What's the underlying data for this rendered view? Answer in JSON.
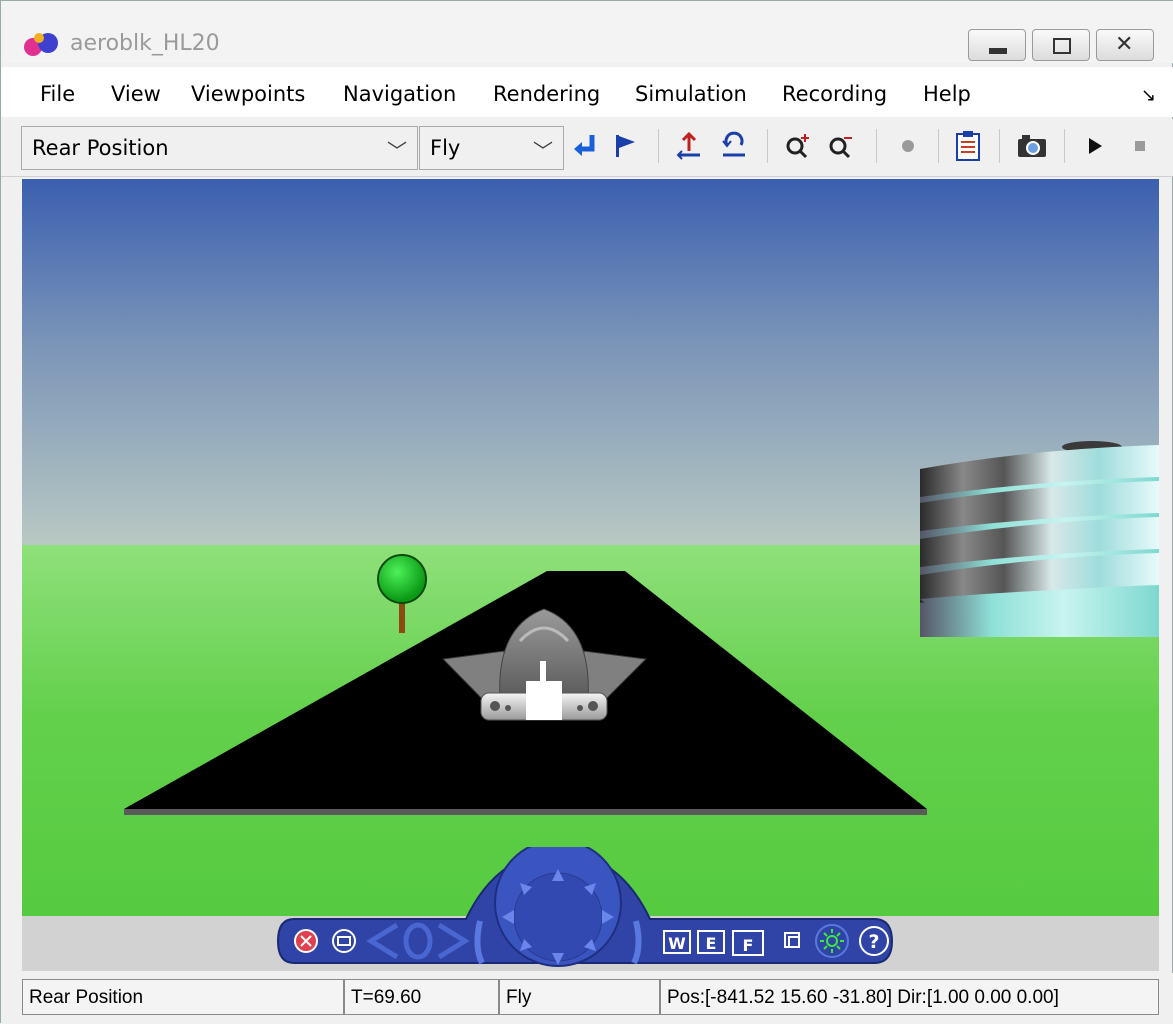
{
  "window": {
    "title": "aeroblk_HL20",
    "controls": [
      "minimize",
      "maximize",
      "close"
    ]
  },
  "menu": {
    "items": [
      "File",
      "View",
      "Viewpoints",
      "Navigation",
      "Rendering",
      "Simulation",
      "Recording",
      "Help"
    ]
  },
  "toolbar": {
    "viewpoint_select": "Rear Position",
    "navigation_select": "Fly",
    "icons": [
      "return-to-viewpoint-icon",
      "flag-icon",
      "straighten-up-icon",
      "undo-move-icon",
      "zoom-in-icon",
      "zoom-out-icon",
      "record-icon",
      "clipboard-icon",
      "camera-icon",
      "play-icon",
      "stop-icon"
    ]
  },
  "navpanel": {
    "buttons": [
      "W",
      "E",
      "F",
      "?"
    ]
  },
  "status": {
    "viewpoint": "Rear Position",
    "time": "T=69.60",
    "mode": "Fly",
    "position": "Pos:[-841.52 15.60 -31.80] Dir:[1.00 0.00 0.00]"
  },
  "colors": {
    "sky_top": "#3b5fb0",
    "sky_horizon": "#b9c9c3",
    "ground": "#5fcf4a",
    "runway": "#000000",
    "nav_panel": "#3246a8"
  }
}
